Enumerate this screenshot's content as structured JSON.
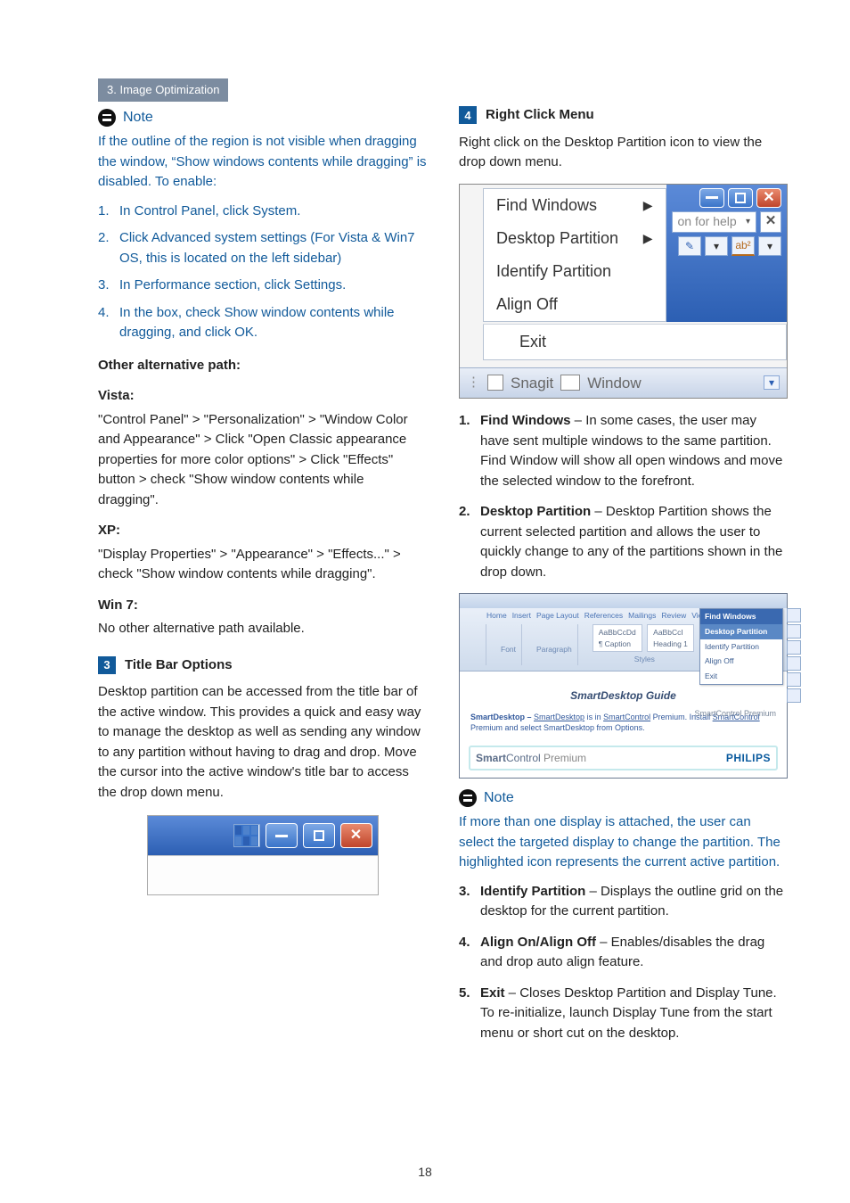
{
  "page_number": "18",
  "badge": "3. Image Optimization",
  "left": {
    "note_title": "Note",
    "note_text": "If the outline of the region is not visible when dragging the window, “Show windows contents while dragging” is disabled. To enable:",
    "steps": [
      "In Control Panel, click System.",
      "Click Advanced system settings (For Vista & Win7 OS, this is located on the left sidebar)",
      "In Performance section, click Settings.",
      "In the box, check Show window contents while dragging, and click OK."
    ],
    "other_alt_heading": "Other alternative path:",
    "vista_heading": "Vista:",
    "vista_text": "\"Control Panel\" > \"Personalization\" > \"Window Color and Appearance\" > Click \"Open Classic appearance properties for more color options\" > Click \"Effects\" button > check \"Show window contents while dragging\".",
    "xp_heading": "XP:",
    "xp_text": "\"Display Properties\" > \"Appearance\" > \"Effects...\" > check \"Show window contents while dragging\".",
    "win7_heading": "Win 7:",
    "win7_text": "No other alternative path available.",
    "sec3_num": "3",
    "sec3_title": "Title Bar Options",
    "sec3_text": "Desktop partition can be accessed from the title bar of the active window. This provides a quick and easy way to manage the desktop as well as sending any window to any partition without having to drag and drop. Move the cursor into the active window's title bar to access the drop down menu."
  },
  "right": {
    "sec4_num": "4",
    "sec4_title": "Right Click Menu",
    "sec4_text": "Right click on the Desktop Partition icon to view the drop down menu.",
    "menu": {
      "find_windows": "Find Windows",
      "desktop_partition": "Desktop Partition",
      "identify_partition": "Identify Partition",
      "align_off": "Align Off",
      "exit": "Exit",
      "help_placeholder": "on for help",
      "snagit": "Snagit",
      "window": "Window",
      "abc": "ab²"
    },
    "list": [
      {
        "lead": "Find Windows",
        "text": " – In some cases, the user may have sent multiple windows to the same partition. Find Window will show all open windows and move the selected window to the forefront."
      },
      {
        "lead": "Desktop Partition",
        "text": " – Desktop Partition shows the current selected partition and allows the user to quickly change to any of the partitions shown in the drop down."
      }
    ],
    "fig3": {
      "tabs": [
        "Home",
        "Insert",
        "Page Layout",
        "References",
        "Mailings",
        "Review",
        "View"
      ],
      "style1": "AaBbCcDd",
      "style2": "AaBbCcI",
      "cap1": "¶ Caption",
      "cap2": "Heading 1",
      "grp_font": "Font",
      "grp_para": "Paragraph",
      "grp_styles": "Styles",
      "popup_hdr": "Find Windows",
      "popup_items": [
        "Desktop Partition",
        "Identify Partition",
        "Align Off",
        "Exit"
      ],
      "body_title": "SmartDesktop Guide",
      "body_text_prefix": "SmartDesktop – ",
      "body_link1": "SmartDesktop",
      "body_text_mid1": " is in ",
      "body_link2": "SmartControl",
      "body_text_mid2": " Premium.  Install ",
      "body_link3": "SmartControl",
      "body_text_suffix": " Premium and select SmartDesktop from Options.",
      "foot_chip": "SmartControl Premium",
      "foot_sc1": "Smart",
      "foot_sc2": "Control",
      "foot_sc3": " Premium",
      "foot_philips": "PHILIPS"
    },
    "note2_title": "Note",
    "note2_text": "If more than one display is attached, the user can select the targeted display to change the partition. The highlighted icon represents the current active partition.",
    "list2": [
      {
        "num": "3.",
        "lead": "Identify Partition",
        "text": " – Displays the outline grid on the desktop for the current partition."
      },
      {
        "num": "4.",
        "lead": "Align On/Align Off",
        "text": " – Enables/disables the drag and drop auto align feature."
      },
      {
        "num": "5.",
        "lead": "Exit",
        "text": " – Closes Desktop Partition and Display Tune. To re-initialize, launch Display Tune from the start menu or short cut on the desktop."
      }
    ]
  }
}
